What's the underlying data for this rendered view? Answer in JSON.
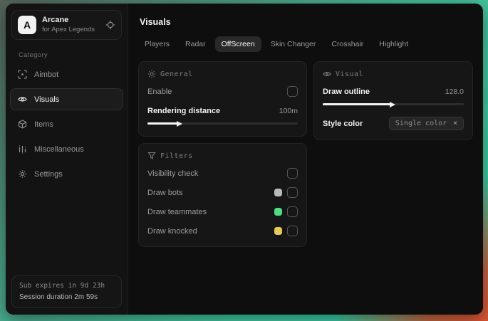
{
  "app": {
    "name": "Arcane",
    "subtitle": "for Apex Legends",
    "logo_letter": "A"
  },
  "sidebar": {
    "category_label": "Category",
    "items": [
      {
        "label": "Aimbot"
      },
      {
        "label": "Visuals",
        "selected": true
      },
      {
        "label": "Items"
      },
      {
        "label": "Miscellaneous"
      },
      {
        "label": "Settings"
      }
    ],
    "footer": {
      "sub_expires": "Sub expires in 9d 23h",
      "session_duration": "Session duration 2m 59s"
    }
  },
  "main": {
    "title": "Visuals",
    "tabs": [
      {
        "label": "Players"
      },
      {
        "label": "Radar"
      },
      {
        "label": "OffScreen",
        "selected": true
      },
      {
        "label": "Skin Changer"
      },
      {
        "label": "Crosshair"
      },
      {
        "label": "Highlight"
      }
    ],
    "panels": {
      "general": {
        "title": "General",
        "enable_label": "Enable",
        "enable_checked": false,
        "rendering_label": "Rendering distance",
        "rendering_value": "100m",
        "rendering_fill": "width:20%"
      },
      "visual": {
        "title": "Visual",
        "outline_label": "Draw outline",
        "outline_value": "128.0",
        "outline_fill": "width:48%",
        "style_label": "Style color",
        "style_value": "Single color",
        "style_clear": "×"
      },
      "filters": {
        "title": "Filters",
        "rows": [
          {
            "label": "Visibility check"
          },
          {
            "label": "Draw bots",
            "swatch": "#b9b9b9"
          },
          {
            "label": "Draw teammates",
            "swatch": "#4ade80"
          },
          {
            "label": "Draw knocked",
            "swatch": "#e7c94f"
          }
        ]
      }
    }
  },
  "colors": {
    "accent_teal": "#2fd3a8",
    "accent_red": "#e05330",
    "swatch_bots": "#b9b9b9",
    "swatch_teammates": "#4ade80",
    "swatch_knocked": "#e7c94f"
  }
}
